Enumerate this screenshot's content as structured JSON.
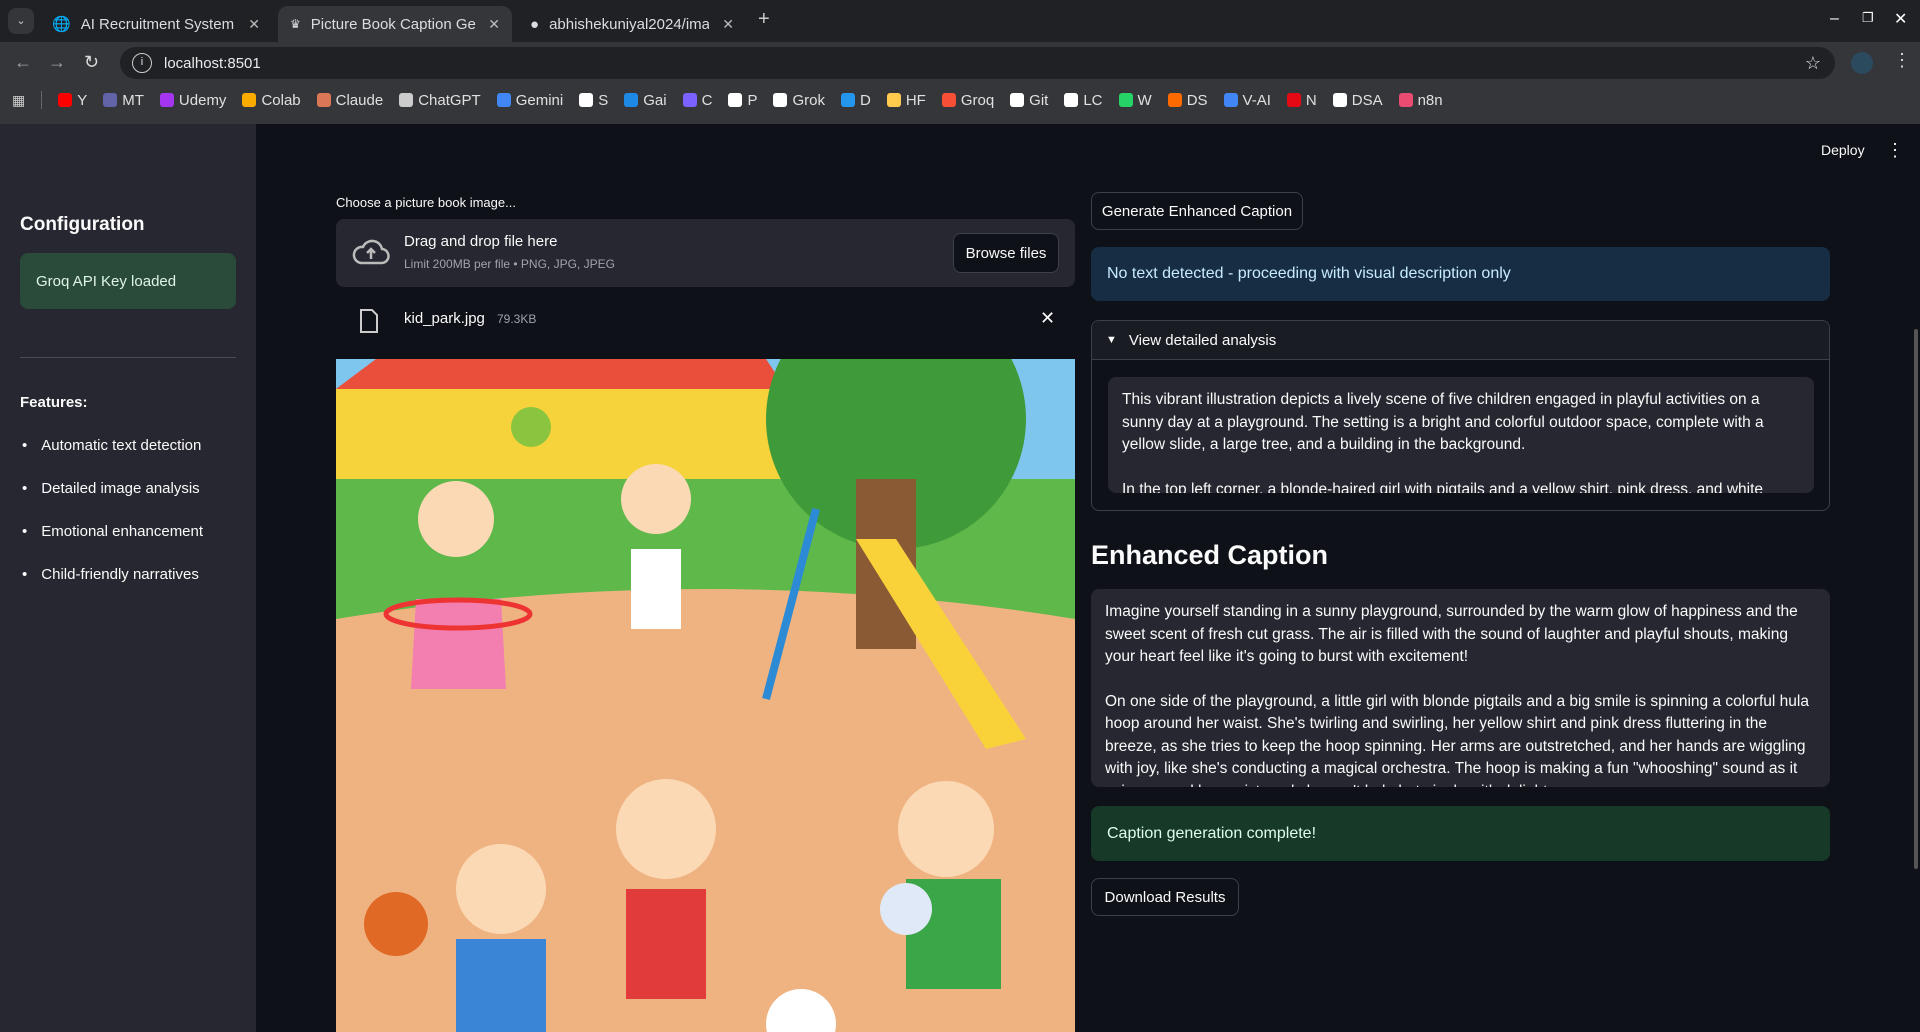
{
  "browser": {
    "tabs": [
      {
        "title": "AI Recruitment System"
      },
      {
        "title": "Picture Book Caption Ge"
      },
      {
        "title": "abhishekuniyal2024/ima"
      }
    ],
    "url": "localhost:8501",
    "bookmarks": [
      "Y",
      "MT",
      "Udemy",
      "Colab",
      "Claude",
      "ChatGPT",
      "Gemini",
      "S",
      "Gai",
      "C",
      "P",
      "Grok",
      "D",
      "HF",
      "Groq",
      "Git",
      "LC",
      "W",
      "DS",
      "V-AI",
      "N",
      "DSA",
      "n8n"
    ],
    "bookmark_colors": [
      "#ff0000",
      "#6264a7",
      "#a435f0",
      "#f9ab00",
      "#d97757",
      "#cccccc",
      "#4285f4",
      "#ffffff",
      "#1e88e5",
      "#7b61ff",
      "#ffffff",
      "#ffffff",
      "#2496ed",
      "#ffcc4d",
      "#f55036",
      "#ffffff",
      "#ffffff",
      "#25d366",
      "#ff6a00",
      "#4285f4",
      "#e50914",
      "#ffffff",
      "#ea4b71"
    ]
  },
  "app": {
    "deploy_label": "Deploy",
    "sidebar": {
      "heading": "Configuration",
      "api_status": "Groq API Key loaded",
      "features_label": "Features:",
      "features": [
        "Automatic text detection",
        "Detailed image analysis",
        "Emotional enhancement",
        "Child-friendly narratives"
      ]
    },
    "uploader": {
      "label": "Choose a picture book image...",
      "drop_text": "Drag and drop file here",
      "limit_text": "Limit 200MB per file • PNG, JPG, JPEG",
      "browse_label": "Browse files",
      "file_name": "kid_park.jpg",
      "file_size": "79.3KB"
    },
    "generate_label": "Generate Enhanced Caption",
    "info_message": "No text detected - proceeding with visual description only",
    "expander": {
      "label": "View detailed analysis",
      "paragraphs": [
        "This vibrant illustration depicts a lively scene of five children engaged in playful activities on a sunny day at a playground. The setting is a bright and colorful outdoor space, complete with a yellow slide, a large tree, and a building in the background.",
        "In the top left corner, a blonde-haired girl with pigtails and a yellow shirt, pink dress, and white tights"
      ]
    },
    "caption_heading": "Enhanced Caption",
    "caption_paragraphs": [
      "Imagine yourself standing in a sunny playground, surrounded by the warm glow of happiness and the sweet scent of fresh cut grass. The air is filled with the sound of laughter and playful shouts, making your heart feel like it's going to burst with excitement!",
      "On one side of the playground, a little girl with blonde pigtails and a big smile is spinning a colorful hula hoop around her waist. She's twirling and swirling, her yellow shirt and pink dress fluttering in the breeze, as she tries to keep the hoop spinning. Her arms are outstretched, and her hands are wiggling with joy, like she's conducting a magical orchestra. The hoop is making a fun \"whooshing\" sound as it spins around her waist, and she can't help but giggle with delight."
    ],
    "success_message": "Caption generation complete!",
    "download_label": "Download Results"
  }
}
